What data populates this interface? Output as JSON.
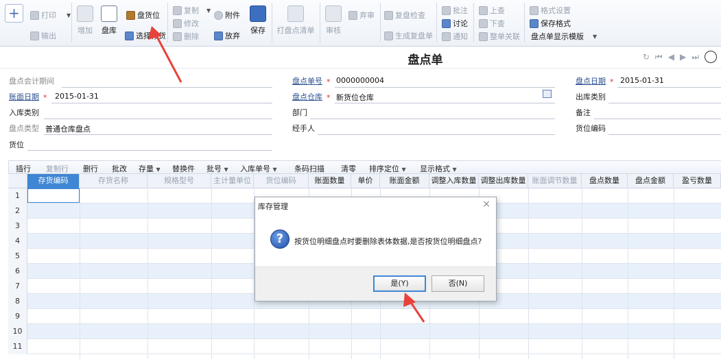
{
  "toolbar": {
    "add": "+",
    "print": "打印",
    "export": "输出",
    "new": "增加",
    "inventory": "盘库",
    "location_count": "盘货位",
    "select_location": "选择存货",
    "copy": "复制",
    "modify": "修改",
    "delete": "删除",
    "attach": "附件",
    "abandon": "放弃",
    "save": "保存",
    "print_list": "打盘点清单",
    "audit": "审核",
    "unaudit": "弃审",
    "recheck": "复盘检查",
    "gen_recheck": "生成复盘单",
    "annotate": "批注",
    "discuss": "讨论",
    "notify": "通知",
    "lookup_up": "上查",
    "lookup_down": "下查",
    "link_all": "整单关联",
    "format_settings": "格式设置",
    "save_format": "保存格式",
    "template": "盘点单显示模版"
  },
  "title": "盘点单",
  "form": {
    "period_label": "盘点会计期间",
    "period_value": "",
    "book_date_label": "账面日期",
    "book_date_value": "2015-01-31",
    "in_type_label": "入库类别",
    "count_type_label": "盘点类型",
    "count_type_value": "普通仓库盘点",
    "location_label": "货位",
    "doc_no_label": "盘点单号",
    "doc_no_value": "0000000004",
    "warehouse_label": "盘点仓库",
    "warehouse_value": "新货位仓库",
    "dept_label": "部门",
    "handler_label": "经手人",
    "count_date_label": "盘点日期",
    "count_date_value": "2015-01-31",
    "out_type_label": "出库类别",
    "remark_label": "备注",
    "loc_code_label": "货位编码"
  },
  "grid_toolbar": {
    "insert": "插行",
    "copy_row": "复制行",
    "delete_row": "删行",
    "batch_edit": "批改",
    "stock": "存量",
    "replace": "替换件",
    "batch_no": "批号",
    "in_no": "入库单号",
    "barcode": "条码扫描",
    "clear": "清零",
    "sort": "排序定位",
    "display_format": "显示格式"
  },
  "grid": {
    "columns": [
      "存货编码",
      "存货名称",
      "规格型号",
      "主计量单位",
      "货位编码",
      "账面数量",
      "单价",
      "账面金额",
      "调整入库数量",
      "调整出库数量",
      "账面调节数量",
      "盘点数量",
      "盘点金额",
      "盈亏数量"
    ],
    "rows": [
      "1",
      "2",
      "3",
      "4",
      "5",
      "6",
      "7",
      "8",
      "9",
      "10",
      "11"
    ]
  },
  "dialog": {
    "title": "库存管理",
    "close": "×",
    "icon": "?",
    "message": "按货位明细盘点时要删除表体数据,是否按货位明细盘点?",
    "yes": "是(Y)",
    "no": "否(N)"
  },
  "colors": {
    "accent": "#3f86d4",
    "arrow": "#e8423a",
    "link": "#2a4f8f"
  }
}
